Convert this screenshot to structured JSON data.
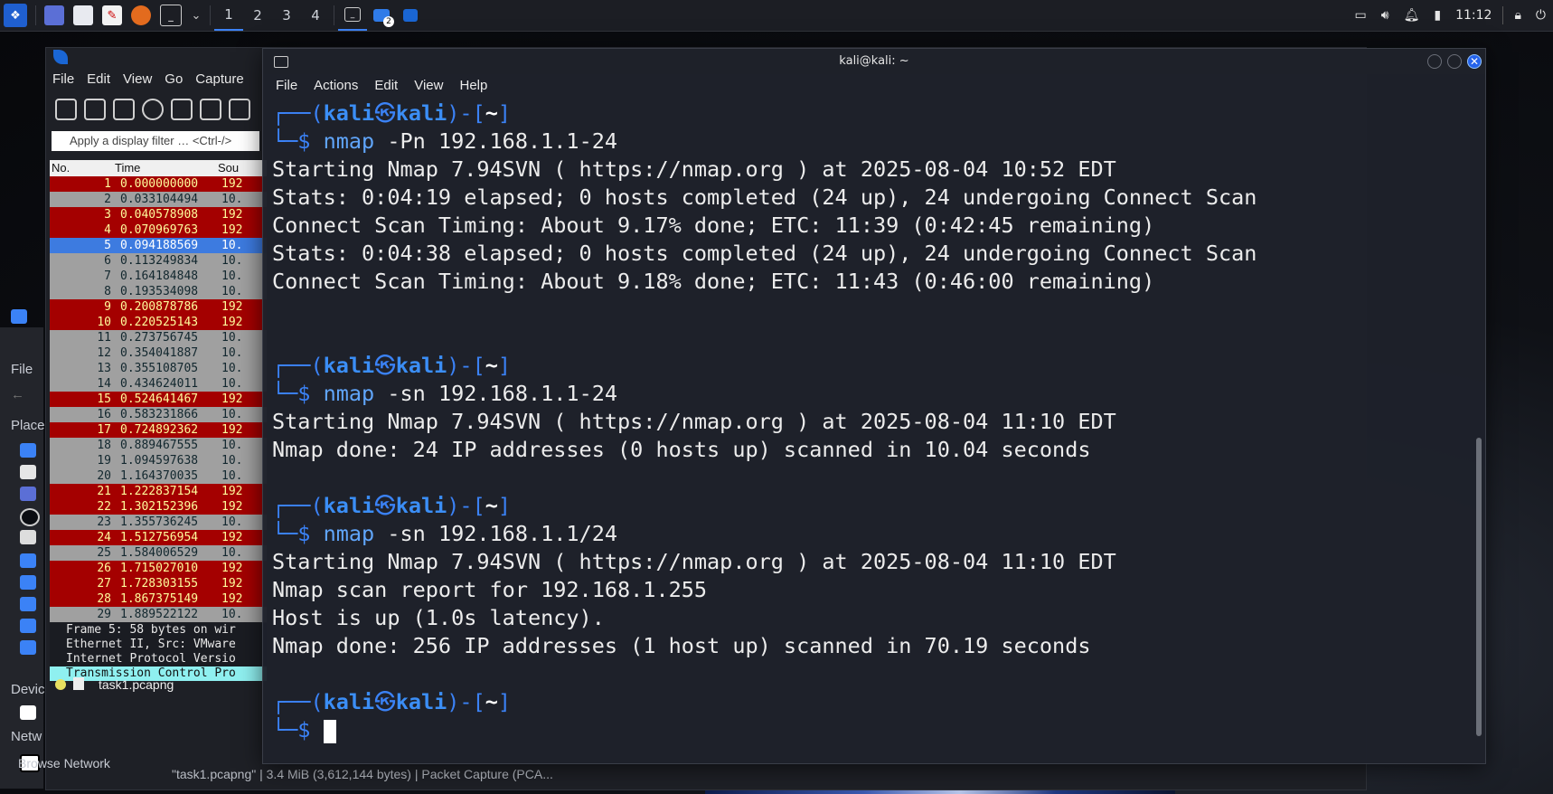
{
  "taskbar": {
    "workspaces": [
      "1",
      "2",
      "3",
      "4"
    ],
    "active_workspace": "1",
    "badge": "2",
    "clock": "11:12"
  },
  "wireshark": {
    "menu": [
      "File",
      "Edit",
      "View",
      "Go",
      "Capture"
    ],
    "filter_placeholder": "Apply a display filter … <Ctrl-/>",
    "columns": [
      "No.",
      "Time",
      "Sou"
    ],
    "packets": [
      {
        "no": "1",
        "time": "0.000000000",
        "src": "192",
        "color": "red"
      },
      {
        "no": "2",
        "time": "0.033104494",
        "src": "10.",
        "color": "grey"
      },
      {
        "no": "3",
        "time": "0.040578908",
        "src": "192",
        "color": "red"
      },
      {
        "no": "4",
        "time": "0.070969763",
        "src": "192",
        "color": "red"
      },
      {
        "no": "5",
        "time": "0.094188569",
        "src": "10.",
        "color": "sel"
      },
      {
        "no": "6",
        "time": "0.113249834",
        "src": "10.",
        "color": "grey"
      },
      {
        "no": "7",
        "time": "0.164184848",
        "src": "10.",
        "color": "grey"
      },
      {
        "no": "8",
        "time": "0.193534098",
        "src": "10.",
        "color": "grey"
      },
      {
        "no": "9",
        "time": "0.200878786",
        "src": "192",
        "color": "red"
      },
      {
        "no": "10",
        "time": "0.220525143",
        "src": "192",
        "color": "red"
      },
      {
        "no": "11",
        "time": "0.273756745",
        "src": "10.",
        "color": "grey"
      },
      {
        "no": "12",
        "time": "0.354041887",
        "src": "10.",
        "color": "grey"
      },
      {
        "no": "13",
        "time": "0.355108705",
        "src": "10.",
        "color": "grey"
      },
      {
        "no": "14",
        "time": "0.434624011",
        "src": "10.",
        "color": "grey"
      },
      {
        "no": "15",
        "time": "0.524641467",
        "src": "192",
        "color": "red"
      },
      {
        "no": "16",
        "time": "0.583231866",
        "src": "10.",
        "color": "grey"
      },
      {
        "no": "17",
        "time": "0.724892362",
        "src": "192",
        "color": "red"
      },
      {
        "no": "18",
        "time": "0.889467555",
        "src": "10.",
        "color": "grey"
      },
      {
        "no": "19",
        "time": "1.094597638",
        "src": "10.",
        "color": "grey"
      },
      {
        "no": "20",
        "time": "1.164370035",
        "src": "10.",
        "color": "grey"
      },
      {
        "no": "21",
        "time": "1.222837154",
        "src": "192",
        "color": "red"
      },
      {
        "no": "22",
        "time": "1.302152396",
        "src": "192",
        "color": "red"
      },
      {
        "no": "23",
        "time": "1.355736245",
        "src": "10.",
        "color": "grey"
      },
      {
        "no": "24",
        "time": "1.512756954",
        "src": "192",
        "color": "red"
      },
      {
        "no": "25",
        "time": "1.584006529",
        "src": "10.",
        "color": "grey"
      },
      {
        "no": "26",
        "time": "1.715027010",
        "src": "192",
        "color": "red"
      },
      {
        "no": "27",
        "time": "1.728303155",
        "src": "192",
        "color": "red"
      },
      {
        "no": "28",
        "time": "1.867375149",
        "src": "192",
        "color": "red"
      },
      {
        "no": "29",
        "time": "1.889522122",
        "src": "10.",
        "color": "grey"
      }
    ],
    "details": [
      "Frame 5: 58 bytes on wir",
      "Ethernet II, Src: VMware",
      "Internet Protocol Versio",
      "Transmission Control Pro"
    ],
    "status_file": "task1.pcapng",
    "fm_status": "\"task1.pcapng\" | 3.4 MiB (3,612,144 bytes) | Packet Capture (PCA..."
  },
  "file_manager": {
    "labels": [
      "File",
      "Place",
      "Devic",
      "Netw"
    ],
    "browse_network": "Browse Network"
  },
  "terminal": {
    "title": "kali@kali: ~",
    "menu": [
      "File",
      "Actions",
      "Edit",
      "View",
      "Help"
    ],
    "blocks": [
      {
        "cmd": "nmap",
        "args": " -Pn 192.168.1.1-24",
        "output": [
          "Starting Nmap 7.94SVN ( https://nmap.org ) at 2025-08-04 10:52 EDT",
          "Stats: 0:04:19 elapsed; 0 hosts completed (24 up), 24 undergoing Connect Scan",
          "Connect Scan Timing: About 9.17% done; ETC: 11:39 (0:42:45 remaining)",
          "Stats: 0:04:38 elapsed; 0 hosts completed (24 up), 24 undergoing Connect Scan",
          "Connect Scan Timing: About 9.18% done; ETC: 11:43 (0:46:00 remaining)",
          "",
          ""
        ]
      },
      {
        "cmd": "nmap",
        "args": " -sn 192.168.1.1-24",
        "output": [
          "Starting Nmap 7.94SVN ( https://nmap.org ) at 2025-08-04 11:10 EDT",
          "Nmap done: 24 IP addresses (0 hosts up) scanned in 10.04 seconds",
          ""
        ]
      },
      {
        "cmd": "nmap",
        "args": " -sn 192.168.1.1/24",
        "output": [
          "Starting Nmap 7.94SVN ( https://nmap.org ) at 2025-08-04 11:10 EDT",
          "Nmap scan report for 192.168.1.255",
          "Host is up (1.0s latency).",
          "Nmap done: 256 IP addresses (1 host up) scanned in 70.19 seconds",
          ""
        ]
      }
    ],
    "prompt": {
      "open": "┌──(",
      "user": "kali",
      "at": "㉿",
      "host": "kali",
      "mid": ")-[",
      "dir": "~",
      "close": "]",
      "second": "└─",
      "dollar": "$"
    }
  },
  "colors": {
    "accent": "#3b82f6",
    "pkt_red": "#a40000",
    "pkt_grey": "#a0a0a0",
    "pkt_sel": "#3d7be0"
  }
}
